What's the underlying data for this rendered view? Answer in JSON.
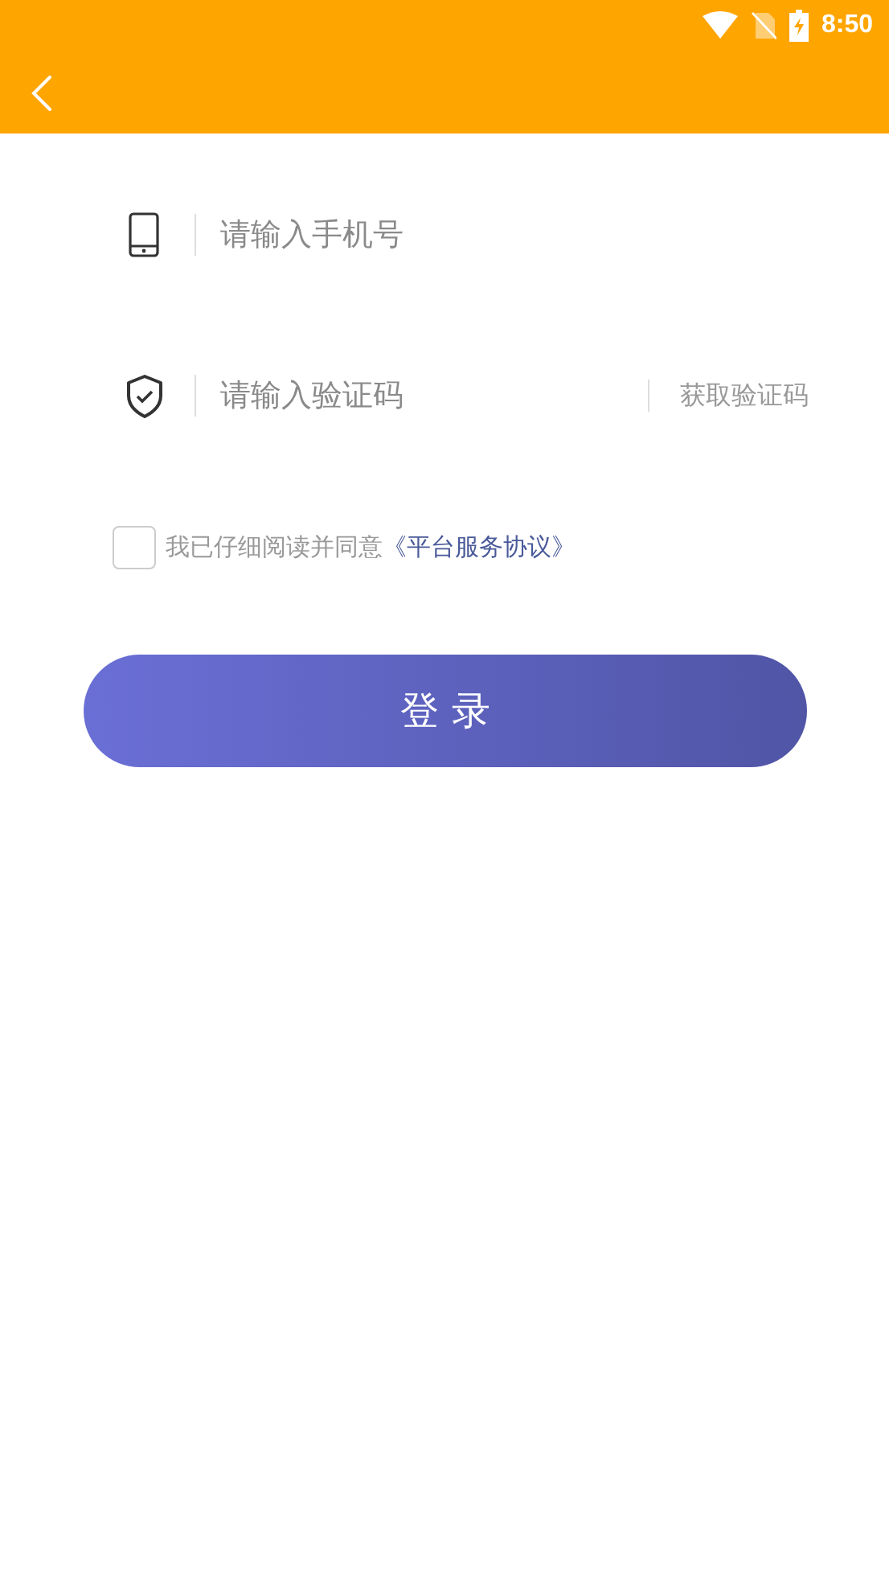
{
  "status_bar": {
    "time": "8:50"
  },
  "fields": [
    {
      "kind": "phone",
      "placeholder": "请输入手机号"
    },
    {
      "kind": "code",
      "placeholder": "请输入验证码",
      "action": "获取验证码"
    }
  ],
  "agreement": {
    "checked": false,
    "text": "我已仔细阅读并同意",
    "link": "《平台服务协议》"
  },
  "login_button": "登 录"
}
